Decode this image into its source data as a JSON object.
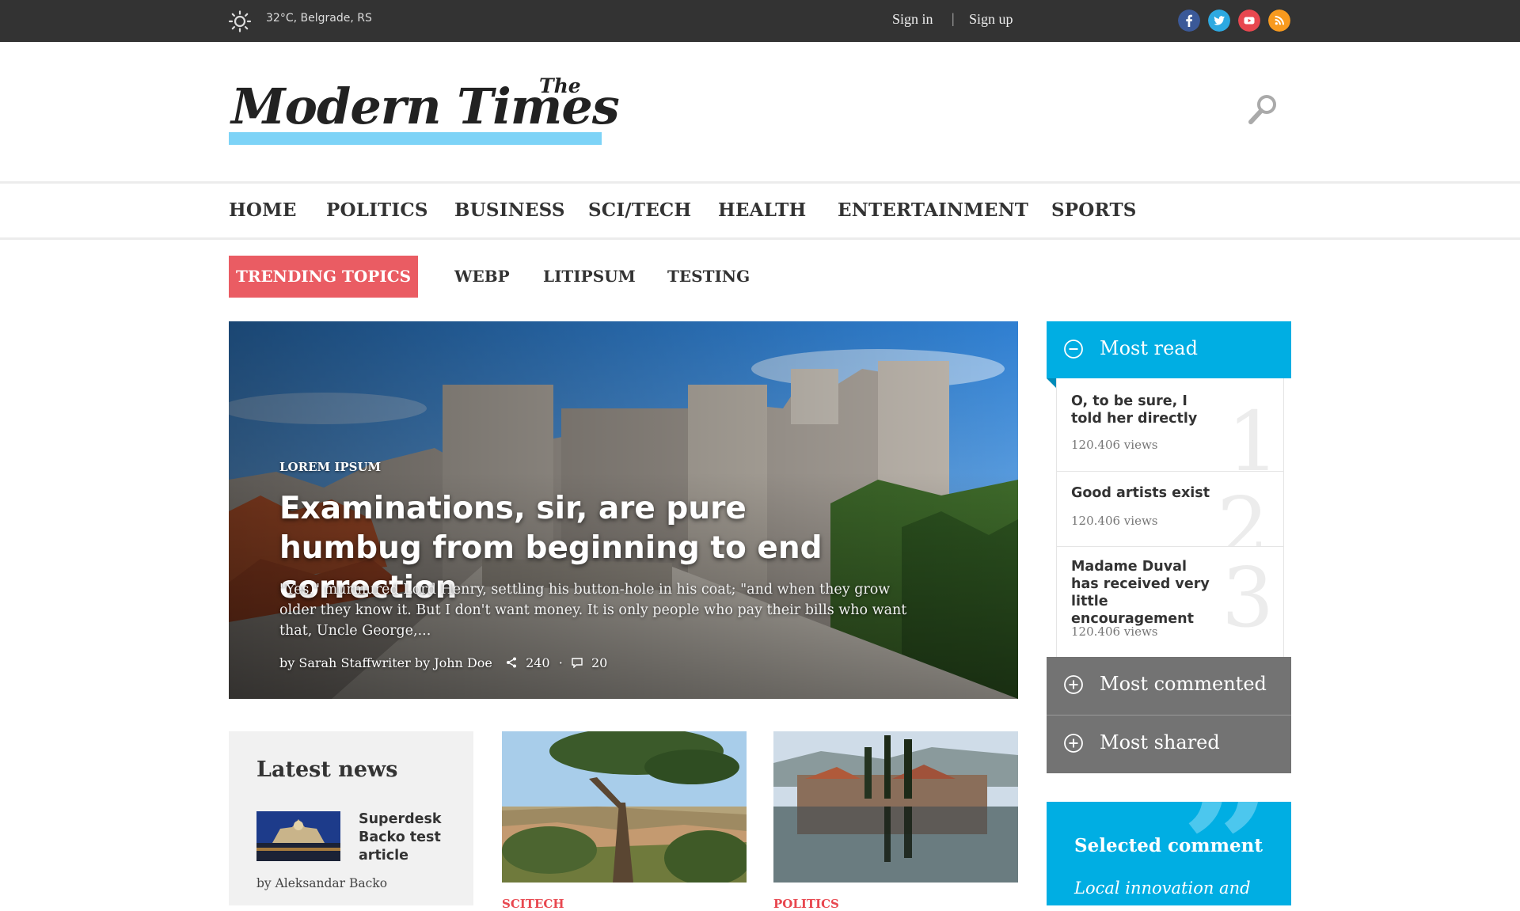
{
  "topbar": {
    "weather": "32°C, Belgrade, RS",
    "sign_in": "Sign in",
    "separator": "|",
    "sign_up": "Sign up",
    "social": [
      {
        "icon": "facebook-icon",
        "color": "#3b5998"
      },
      {
        "icon": "twitter-icon",
        "color": "#2da9e1"
      },
      {
        "icon": "youtube-icon",
        "color": "#e8474f"
      },
      {
        "icon": "rss-icon",
        "color": "#f89a1e"
      }
    ]
  },
  "header": {
    "logo_the": "The",
    "logo_main": "Modern Times",
    "logo_accent": "#7dd3f7"
  },
  "nav": {
    "items": [
      "HOME",
      "POLITICS",
      "BUSINESS",
      "SCI/TECH",
      "HEALTH",
      "ENTERTAINMENT",
      "SPORTS"
    ]
  },
  "trending": {
    "label": "TRENDING TOPICS",
    "color": "#ea5c63",
    "topics": [
      "WEBP",
      "LITIPSUM",
      "TESTING"
    ]
  },
  "hero": {
    "category": "LOREM IPSUM",
    "title": "Examinations, sir, are pure humbug from beginning to end correction",
    "excerpt": "\"Yes,\" murmured Lord Henry, settling his button-hole in his coat; \"and when they grow older they know it. But I don't want money. It is only people who pay their bills who want that, Uncle George,...",
    "byline": "by Sarah Staffwriter by John Doe",
    "shares": "240",
    "dot": "·",
    "comments": "20"
  },
  "sidebar": {
    "accent": "#00aee3",
    "most_read_label": "Most read",
    "most_read": [
      {
        "num": "1",
        "title": "O, to be sure, I told her directly",
        "views": "120.406 views"
      },
      {
        "num": "2",
        "title": "Good artists exist",
        "views": "120.406 views"
      },
      {
        "num": "3",
        "title": "Madame Duval has received very little encouragement",
        "views": "120.406 views"
      }
    ],
    "most_commented_label": "Most commented",
    "most_shared_label": "Most shared",
    "selected_comment_title": "Selected comment",
    "selected_comment_text": "Local innovation and",
    "quote_glyph": "”"
  },
  "latest": {
    "title": "Latest news",
    "article_title": "Superdesk Backo test article",
    "article_byline": "by Aleksandar Backo"
  },
  "cards": [
    {
      "category": "SCITECH"
    },
    {
      "category": "POLITICS"
    }
  ]
}
